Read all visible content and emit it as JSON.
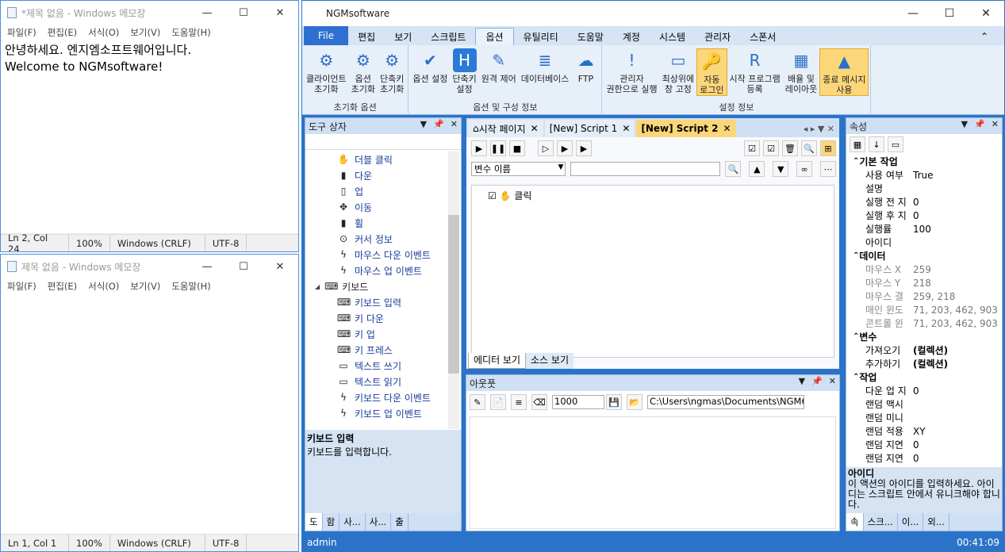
{
  "notepad1": {
    "title": "*제목 없음 - Windows 메모장",
    "menu": [
      "파일(F)",
      "편집(E)",
      "서식(O)",
      "보기(V)",
      "도움말(H)"
    ],
    "content": "안녕하세요. 엔지엠소프트웨어입니다.\nWelcome to NGMsoftware!",
    "status": [
      "Ln 2, Col 24",
      "100%",
      "Windows (CRLF)",
      "UTF-8"
    ]
  },
  "notepad2": {
    "title": "제목 없음 - Windows 메모장",
    "menu": [
      "파일(F)",
      "편집(E)",
      "서식(O)",
      "보기(V)",
      "도움말(H)"
    ],
    "content": "",
    "status": [
      "Ln 1, Col 1",
      "100%",
      "Windows (CRLF)",
      "UTF-8"
    ]
  },
  "app": {
    "title": "NGMsoftware",
    "tabs": [
      "File",
      "편집",
      "보기",
      "스크립트",
      "옵션",
      "유틸리티",
      "도움말",
      "계정",
      "시스템",
      "관리자",
      "스폰서"
    ],
    "active_tab": "옵션",
    "groups": [
      {
        "label": "초기화 옵션",
        "buttons": [
          "클라이언트\n초기화",
          "옵션\n초기화",
          "단축키\n초기화"
        ]
      },
      {
        "label": "옵션 및 구성 정보",
        "buttons": [
          "옵션 설정",
          "단축키\n설정",
          "원격 제어",
          "데이터베이스",
          "FTP"
        ]
      },
      {
        "label": "설정 정보",
        "buttons": [
          "관리자\n권한으로 실행",
          "최상위에\n창 고정",
          "자동\n로그인",
          "시작 프로그램\n등록",
          "배율 및\n레이아웃",
          "종료 메시지\n사용"
        ]
      }
    ],
    "toolbox": {
      "title": "도구 상자",
      "items": [
        {
          "icon": "✋",
          "label": "더블 클릭",
          "indent": 2
        },
        {
          "icon": "▮",
          "label": "다운",
          "indent": 2
        },
        {
          "icon": "▯",
          "label": "업",
          "indent": 2
        },
        {
          "icon": "✥",
          "label": "이동",
          "indent": 2
        },
        {
          "icon": "▮",
          "label": "휠",
          "indent": 2
        },
        {
          "icon": "⊙",
          "label": "커서 정보",
          "indent": 2
        },
        {
          "icon": "ϟ",
          "label": "마우스 다운 이벤트",
          "indent": 2
        },
        {
          "icon": "ϟ",
          "label": "마우스 업 이벤트",
          "indent": 2
        },
        {
          "icon": "⌨",
          "label": "키보드",
          "indent": 1
        },
        {
          "icon": "⌨",
          "label": "키보드 입력",
          "indent": 2
        },
        {
          "icon": "⌨",
          "label": "키 다운",
          "indent": 2
        },
        {
          "icon": "⌨",
          "label": "키 업",
          "indent": 2
        },
        {
          "icon": "⌨",
          "label": "키 프레스",
          "indent": 2
        },
        {
          "icon": "▭",
          "label": "텍스트 쓰기",
          "indent": 2
        },
        {
          "icon": "▭",
          "label": "텍스트 읽기",
          "indent": 2
        },
        {
          "icon": "ϟ",
          "label": "키보드 다운 이벤트",
          "indent": 2
        },
        {
          "icon": "ϟ",
          "label": "키보드 업 이벤트",
          "indent": 2
        }
      ],
      "desc_title": "키보드 입력",
      "desc": "키보드를 입력합니다.",
      "bottom_tabs": [
        "도",
        "함",
        "사...",
        "사...",
        "출"
      ]
    },
    "doc_tabs": [
      "시작 페이지",
      "[New] Script 1",
      "[New] Script 2"
    ],
    "var_placeholder": "변수 이름",
    "script_item": "클릭",
    "editor_tabs": [
      "에디터 보기",
      "소스 보기"
    ],
    "output": {
      "title": "아웃풋",
      "count": "1000",
      "path": "C:\\Users\\ngmas\\Documents\\NGM6\\"
    },
    "props": {
      "title": "속성",
      "rows": [
        {
          "cat": "기본 작업"
        },
        {
          "k": "사용 여부",
          "v": "True"
        },
        {
          "k": "설명",
          "v": ""
        },
        {
          "k": "실행 전 지",
          "v": "0"
        },
        {
          "k": "실행 후 지",
          "v": "0"
        },
        {
          "k": "실행률",
          "v": "100"
        },
        {
          "k": "아이디",
          "v": ""
        },
        {
          "cat": "데이터"
        },
        {
          "k": "마우스 X",
          "v": "259",
          "gray": true
        },
        {
          "k": "마우스 Y",
          "v": "218",
          "gray": true
        },
        {
          "k": "마우스 결",
          "v": "259, 218",
          "gray": true
        },
        {
          "k": "매인 윈도",
          "v": "71, 203, 462, 903",
          "gray": true
        },
        {
          "k": "콘트롤 윈",
          "v": "71, 203, 462, 903",
          "gray": true
        },
        {
          "cat": "변수"
        },
        {
          "k": "가져오기",
          "v": "(컬렉션)",
          "bold": true
        },
        {
          "k": "추가하기",
          "v": "(컬렉션)",
          "bold": true
        },
        {
          "cat": "작업"
        },
        {
          "k": "다운 업 지",
          "v": "0"
        },
        {
          "k": "랜덤 맥시",
          "v": ""
        },
        {
          "k": "랜덤 미니",
          "v": ""
        },
        {
          "k": "랜덤 적용",
          "v": "XY"
        },
        {
          "k": "랜덤 지연",
          "v": "0"
        },
        {
          "k": "랜덤 지연",
          "v": "0"
        }
      ],
      "desc_title": "아이디",
      "desc": "이 액션의 아이디를 입력하세요. 아이디는 스크립트 안에서 유니크해야 합니다.",
      "bottom_tabs": [
        "속",
        "스크...",
        "이...",
        "외..."
      ]
    },
    "status_user": "admin",
    "status_time": "00:41:09"
  }
}
